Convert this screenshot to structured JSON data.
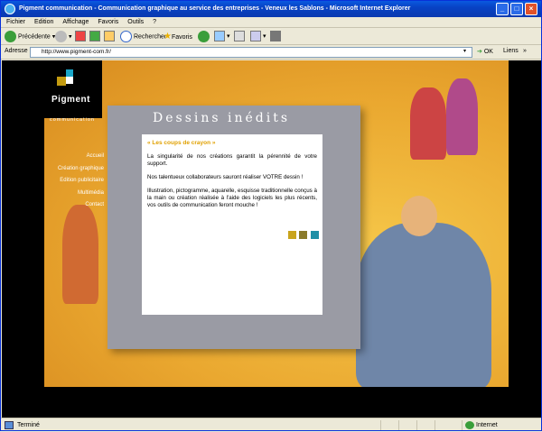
{
  "window": {
    "title": "Pigment communication - Communication graphique au service des entreprises - Veneux les Sablons - Microsoft Internet Explorer"
  },
  "menu": [
    "Fichier",
    "Edition",
    "Affichage",
    "Favoris",
    "Outils",
    "?"
  ],
  "toolbar": {
    "back": "Précédente",
    "search": "Rechercher",
    "favorites": "Favoris"
  },
  "address": {
    "label": "Adresse",
    "url": "http://www.pigment-com.fr/",
    "go": "OK",
    "links": "Liens"
  },
  "site": {
    "logo_text": "Pigment",
    "logo_sub": "communication",
    "nav": [
      "Accueil",
      "Création graphique",
      "Edition publicitaire",
      "Multimédia",
      "Contact"
    ],
    "panel_title": "Dessins inédits",
    "heading": "« Les coups de crayon »",
    "paragraphs": [
      "La singularité de nos créations garantit la pérennité de votre support.",
      "Nos talentueux collaborateurs sauront réaliser VOTRE dessin !",
      "Illustration, pictogramme, aquarelle, esquisse traditionnelle conçus à la main ou création réalisée à l'aide des logiciels les plus récents, vos outils de communication feront mouche !"
    ],
    "swatch_colors": [
      "#c9a41c",
      "#8a7a2a",
      "#1e8fa6"
    ]
  },
  "status": {
    "text": "Terminé",
    "zone": "Internet"
  }
}
